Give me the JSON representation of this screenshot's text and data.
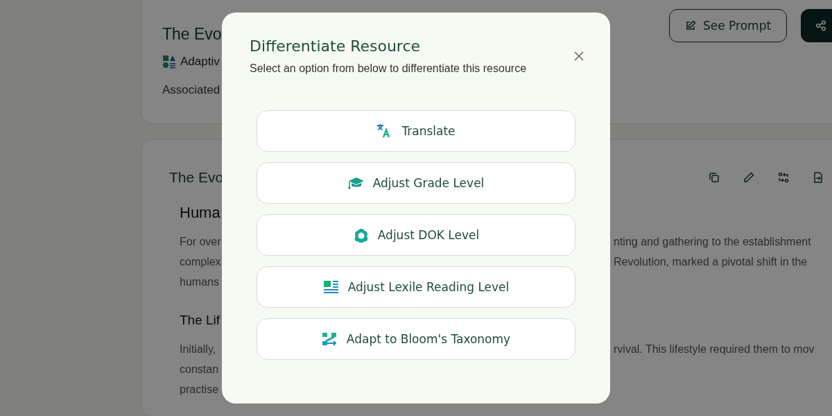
{
  "header_card": {
    "title": "The Evo",
    "type_label": "Adaptiv",
    "associated": "Associated",
    "buttons": [
      {
        "kind": "outline",
        "label": "See Prompt"
      },
      {
        "kind": "primary"
      }
    ]
  },
  "content_card": {
    "title": "The Evo",
    "sections": [
      {
        "heading": "Huma",
        "lines": [
          {
            "left": "For over",
            "right": "nting and gathering to the establishment"
          },
          {
            "left": "complex",
            "right": "Revolution, marked a pivotal shift in the"
          },
          {
            "left": "humans"
          }
        ]
      },
      {
        "heading": "The Lif",
        "lines": [
          {
            "left": "Initially,",
            "right": "rvival. This lifestyle required them to mov"
          },
          {
            "left": "constan"
          },
          {
            "left": "practise"
          }
        ]
      }
    ]
  },
  "dialog": {
    "title": "Differentiate Resource",
    "subtitle": "Select an option from below to differentiate this resource",
    "options": [
      {
        "kind": "translate",
        "label": "Translate"
      },
      {
        "kind": "grade",
        "label": "Adjust Grade Level"
      },
      {
        "kind": "dok",
        "label": "Adjust DOK Level"
      },
      {
        "kind": "lexile",
        "label": "Adjust Lexile Reading Level"
      },
      {
        "kind": "bloom",
        "label": "Adapt to Bloom's Taxonomy"
      }
    ]
  }
}
